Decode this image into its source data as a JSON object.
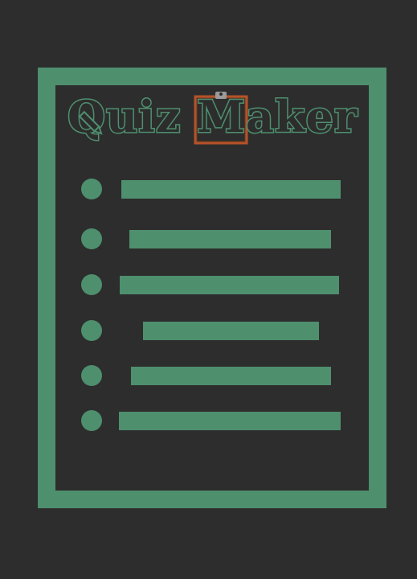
{
  "logo": {
    "text": "Quiz Maker",
    "text_color": "#4e8f6e",
    "accent_color": "#b5522a",
    "icons": [
      "pencil-icon",
      "clipboard-icon"
    ]
  },
  "theme": {
    "background": "#2d2d2d",
    "accent": "#4e8f6e"
  },
  "list": {
    "row_count": 6
  }
}
